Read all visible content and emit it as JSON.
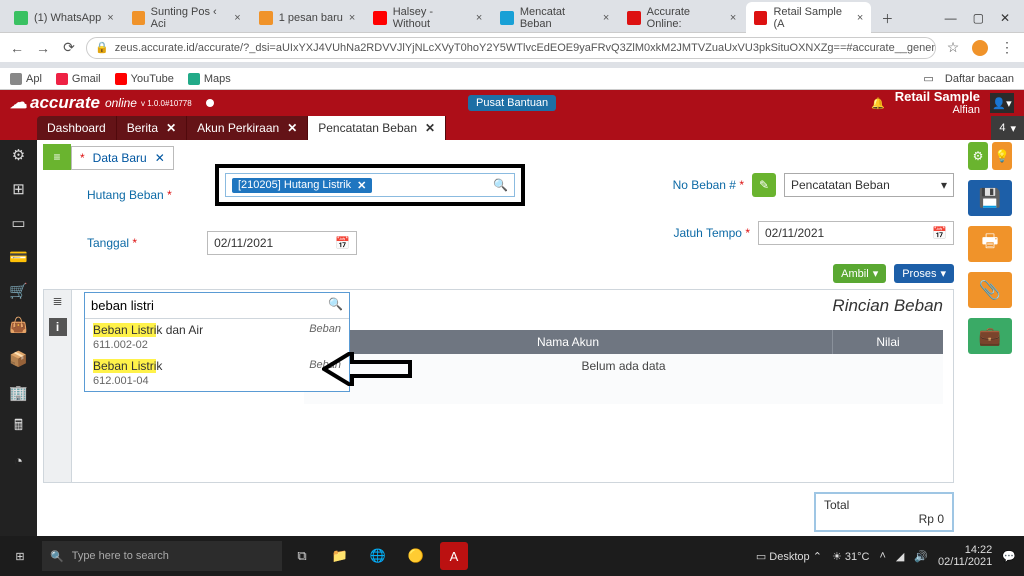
{
  "browser": {
    "tabs": [
      {
        "fav": "#3ac162",
        "title": "(1) WhatsApp"
      },
      {
        "fav": "#f0932a",
        "title": "Sunting Pos ‹ Aci"
      },
      {
        "fav": "#f0932a",
        "title": "1 pesan baru"
      },
      {
        "fav": "#ff0000",
        "title": "Halsey - Without"
      },
      {
        "fav": "#18a0d6",
        "title": "Mencatat Beban"
      },
      {
        "fav": "#d11",
        "title": "Accurate Online:"
      },
      {
        "fav": "#d11",
        "title": "Retail Sample (A"
      }
    ],
    "url": "zeus.accurate.id/accurate/?_dsi=aUIxYXJ4VUhNa2RDVVJlYjNLcXVyT0hoY2Y5WTlvcEdEOE9yaFRvQ3ZlM0xkM2JMTVZuaUxVU3pkSituOXNXZg==#accurate__general-ledger__e...",
    "bookmarks": {
      "apl": "Apl",
      "gmail": "Gmail",
      "youtube": "YouTube",
      "maps": "Maps",
      "daftar": "Daftar bacaan"
    }
  },
  "app": {
    "brand": "accurate",
    "brand_sub": "online",
    "version": "v 1.0.0#10778",
    "pusat": "Pusat Bantuan",
    "bell": "🔔",
    "company": "Retail Sample",
    "user": "Alfian",
    "tabs": [
      {
        "label": "Dashboard"
      },
      {
        "label": "Berita",
        "close": "✕"
      },
      {
        "label": "Akun Perkiraan",
        "close": "✕"
      },
      {
        "label": "Pencatatan Beban",
        "close": "✕"
      }
    ],
    "tab_counter": "4"
  },
  "doc": {
    "title": "Data Baru",
    "hutang_label": "Hutang Beban",
    "hutang_chip": "[210205] Hutang Listrik",
    "tanggal_label": "Tanggal",
    "tanggal_value": "02/11/2021",
    "no_beban_label": "No Beban #",
    "no_beban_value": "Pencatatan Beban",
    "jatuh_label": "Jatuh Tempo",
    "jatuh_value": "02/11/2021",
    "btn_ambil": "Ambil",
    "btn_proses": "Proses",
    "grid_title": "Rincian Beban",
    "col_nama": "Nama Akun",
    "col_nilai": "Nilai",
    "empty": "Belum ada data",
    "total_label": "Total",
    "total_value": "Rp 0"
  },
  "search": {
    "value": "beban listri",
    "items": [
      {
        "hl": "Beban Listri",
        "rest": "k dan Air",
        "code": "611.002-02",
        "tag": "Beban"
      },
      {
        "hl": "Beban Listri",
        "rest": "k",
        "code": "612.001-04",
        "tag": "Beban"
      }
    ]
  },
  "taskbar": {
    "search_placeholder": "Type here to search",
    "desktop": "Desktop",
    "temp": "31°C",
    "time": "14:22",
    "date": "02/11/2021"
  }
}
